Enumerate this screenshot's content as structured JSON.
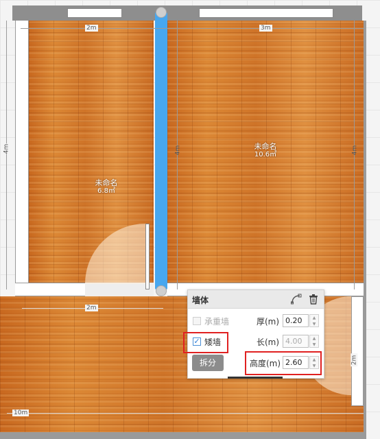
{
  "rooms": [
    {
      "name": "未命名",
      "area": "6.8㎡"
    },
    {
      "name": "未命名",
      "area": "10.6㎡"
    }
  ],
  "dimensions": {
    "top_left": "2m",
    "top_right": "3m",
    "left_side": "4m",
    "mid_wall": "4m",
    "right_side": "4m",
    "lower_mid": "2m",
    "right_lower": "2m",
    "bottom": "10m"
  },
  "panel": {
    "title": "墙体",
    "load_bearing_label": "承重墙",
    "load_bearing_checked": false,
    "short_wall_label": "矮墙",
    "short_wall_checked": true,
    "split_button": "拆分",
    "thickness_label": "厚(m)",
    "thickness_value": "0.20",
    "length_label": "长(m)",
    "length_value": "4.00",
    "height_label": "高度(m)",
    "height_value": "2.60",
    "icons": [
      "curve-wall-icon",
      "trash-icon"
    ]
  },
  "colors": {
    "selected_wall": "#47a7ef",
    "highlight_box": "#e02020",
    "floor": "#d4782a"
  }
}
